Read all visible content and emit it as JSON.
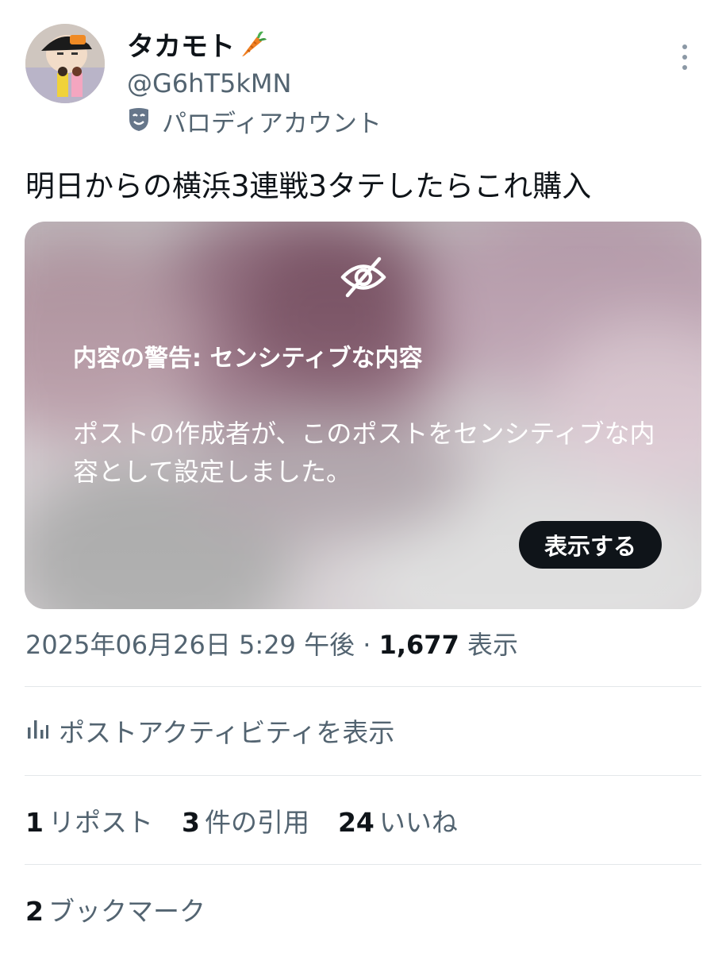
{
  "author": {
    "display_name": "タカモト",
    "emoji_icon": "carrot-icon",
    "handle": "@G6hT5kMN",
    "parody_label": "パロディアカウント",
    "parody_icon": "theater-mask-icon"
  },
  "post": {
    "text": "明日からの横浜3連戦3タテしたらこれ購入"
  },
  "media_warning": {
    "icon": "eye-slash-icon",
    "title": "内容の警告: センシティブな内容",
    "body": "ポストの作成者が、このポストをセンシティブな内容として設定しました。",
    "show_button": "表示する"
  },
  "meta": {
    "timestamp": "2025年06月26日 5:29 午後",
    "separator": "·",
    "views_count": "1,677",
    "views_label": "表示"
  },
  "activity": {
    "icon": "analytics-icon",
    "label": "ポストアクティビティを表示"
  },
  "stats": {
    "reposts_count": "1",
    "reposts_label": "リポスト",
    "quotes_count": "3",
    "quotes_label": "件の引用",
    "likes_count": "24",
    "likes_label": "いいね",
    "bookmarks_count": "2",
    "bookmarks_label": "ブックマーク"
  },
  "colors": {
    "text_primary": "#0f1419",
    "text_secondary": "#536471",
    "button_dark": "#0f1419",
    "divider": "#e3e7ea"
  }
}
